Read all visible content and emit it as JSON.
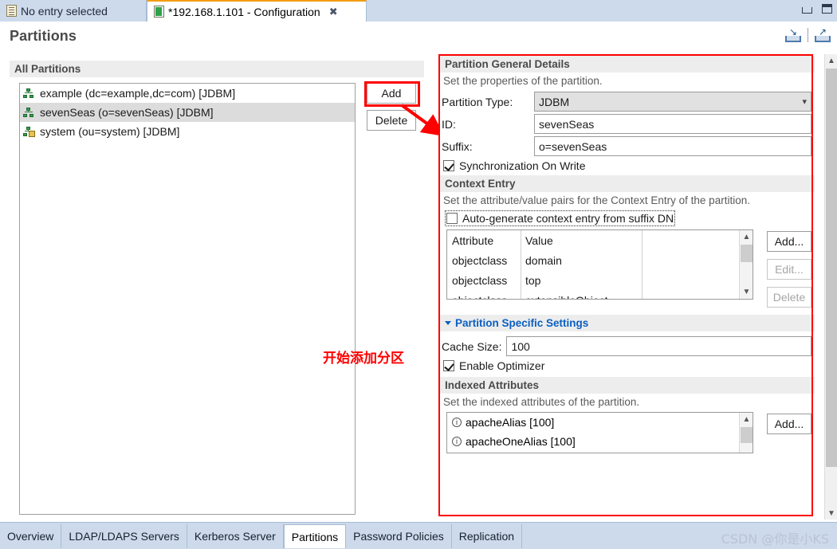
{
  "window": {
    "minimize_label": "–",
    "maximize_label": "□"
  },
  "editor_tabs": [
    {
      "label": "No entry selected",
      "icon": "entry-icon",
      "active": false
    },
    {
      "label": "*192.168.1.101 - Configuration",
      "icon": "config-icon",
      "active": true,
      "close": "✖"
    }
  ],
  "header": {
    "title": "Partitions",
    "import_icon": "import-icon",
    "export_icon": "export-icon"
  },
  "left": {
    "section_title": "All Partitions",
    "items": [
      {
        "label": "example (dc=example,dc=com) [JDBM]",
        "icon": "partition-icon",
        "selected": false
      },
      {
        "label": "sevenSeas (o=sevenSeas) [JDBM]",
        "icon": "partition-icon",
        "selected": true
      },
      {
        "label": "system (ou=system) [JDBM]",
        "icon": "partition-locked-icon",
        "selected": false
      }
    ],
    "add_label": "Add",
    "delete_label": "Delete"
  },
  "annotation": {
    "text": "开始添加分区",
    "color": "#ff0000"
  },
  "general": {
    "section_title": "Partition General Details",
    "description": "Set the properties of the partition.",
    "partition_type_label": "Partition Type:",
    "partition_type_value": "JDBM",
    "id_label": "ID:",
    "id_value": "sevenSeas",
    "suffix_label": "Suffix:",
    "suffix_value": "o=sevenSeas",
    "sync_on_write_label": "Synchronization On Write",
    "sync_on_write_checked": true
  },
  "context_entry": {
    "section_title": "Context Entry",
    "description": "Set the attribute/value pairs for the Context Entry of the partition.",
    "autogen_label": "Auto-generate context entry from suffix DN",
    "autogen_checked": false,
    "columns": [
      "Attribute",
      "Value"
    ],
    "rows": [
      [
        "objectclass",
        "domain"
      ],
      [
        "objectclass",
        "top"
      ],
      [
        "objectclass",
        "extensibleObject"
      ]
    ],
    "add_label": "Add...",
    "edit_label": "Edit...",
    "delete_label": "Delete"
  },
  "specific": {
    "section_title": "Partition Specific Settings",
    "cache_size_label": "Cache Size:",
    "cache_size_value": "100",
    "enable_optimizer_label": "Enable Optimizer",
    "enable_optimizer_checked": true
  },
  "indexed": {
    "section_title": "Indexed Attributes",
    "description": "Set the indexed attributes of the partition.",
    "rows": [
      "apacheAlias [100]",
      "apacheOneAlias [100]"
    ],
    "add_label": "Add..."
  },
  "bottom_tabs": [
    {
      "label": "Overview",
      "active": false
    },
    {
      "label": "LDAP/LDAPS Servers",
      "active": false
    },
    {
      "label": "Kerberos Server",
      "active": false
    },
    {
      "label": "Partitions",
      "active": true
    },
    {
      "label": "Password Policies",
      "active": false
    },
    {
      "label": "Replication",
      "active": false
    }
  ],
  "watermark": "CSDN @你是小KS",
  "colors": {
    "tab_bar": "#cddaeb",
    "accent_link": "#0a5fc2",
    "highlight_red": "#ff0000",
    "selection_gray": "#dcdcdc"
  }
}
